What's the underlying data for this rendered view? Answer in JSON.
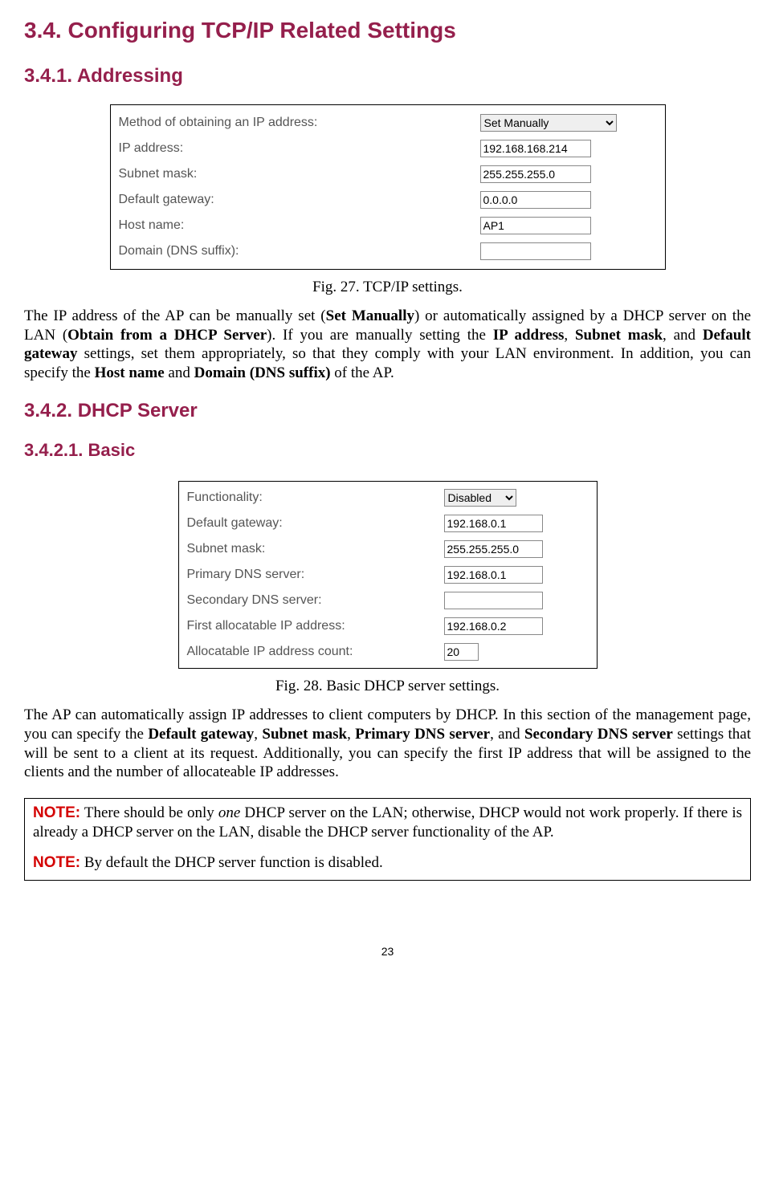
{
  "headings": {
    "h1": "3.4. Configuring TCP/IP Related Settings",
    "h2a": "3.4.1. Addressing",
    "h2b": "3.4.2. DHCP Server",
    "h3a": "3.4.2.1. Basic"
  },
  "fig27": {
    "caption": "Fig. 27. TCP/IP settings.",
    "rows": {
      "method_label": "Method of obtaining an IP address:",
      "method_value": "Set Manually",
      "ip_label": "IP address:",
      "ip_value": "192.168.168.214",
      "subnet_label": "Subnet mask:",
      "subnet_value": "255.255.255.0",
      "gateway_label": "Default gateway:",
      "gateway_value": "0.0.0.0",
      "host_label": "Host name:",
      "host_value": "AP1",
      "domain_label": "Domain (DNS suffix):",
      "domain_value": ""
    }
  },
  "para1": {
    "t1": "The IP address of the AP can be manually set (",
    "b1": "Set Manually",
    "t2": ") or automatically assigned by a DHCP server on the LAN (",
    "b2": "Obtain from a DHCP Server",
    "t3": "). If you are manually setting the ",
    "b3": "IP address",
    "t4": ", ",
    "b4": "Subnet mask",
    "t5": ", and ",
    "b5": "Default gateway",
    "t6": " settings, set them appropriately, so that they comply with your LAN environment. In addition, you can specify the ",
    "b6": "Host name",
    "t7": " and ",
    "b7": "Domain (DNS suffix)",
    "t8": " of the AP."
  },
  "fig28": {
    "caption": "Fig. 28. Basic DHCP server settings.",
    "rows": {
      "func_label": "Functionality:",
      "func_value": "Disabled",
      "gateway_label": "Default gateway:",
      "gateway_value": "192.168.0.1",
      "subnet_label": "Subnet mask:",
      "subnet_value": "255.255.255.0",
      "pdns_label": "Primary DNS server:",
      "pdns_value": "192.168.0.1",
      "sdns_label": "Secondary DNS server:",
      "sdns_value": "",
      "first_label": "First allocatable IP address:",
      "first_value": "192.168.0.2",
      "count_label": "Allocatable IP address count:",
      "count_value": "20"
    }
  },
  "para2": {
    "t1": "The AP can automatically assign IP addresses to client computers by DHCP. In this section of the management page, you can specify the ",
    "b1": "Default gateway",
    "t2": ", ",
    "b2": "Subnet mask",
    "t3": ", ",
    "b3": "Primary DNS server",
    "t4": ", and ",
    "b4": "Secondary DNS server",
    "t5": " settings that will be sent to a client at its request. Additionally, you can specify the first IP address that will be assigned to the clients and the number of allocateable IP addresses."
  },
  "notes": {
    "label": "NOTE:",
    "n1a": " There should be only ",
    "n1i": "one",
    "n1b": " DHCP server on the LAN; otherwise, DHCP would not work properly. If there is already a DHCP server on the LAN, disable the DHCP server functionality of the AP.",
    "n2": " By default the DHCP server function is disabled."
  },
  "page_number": "23"
}
